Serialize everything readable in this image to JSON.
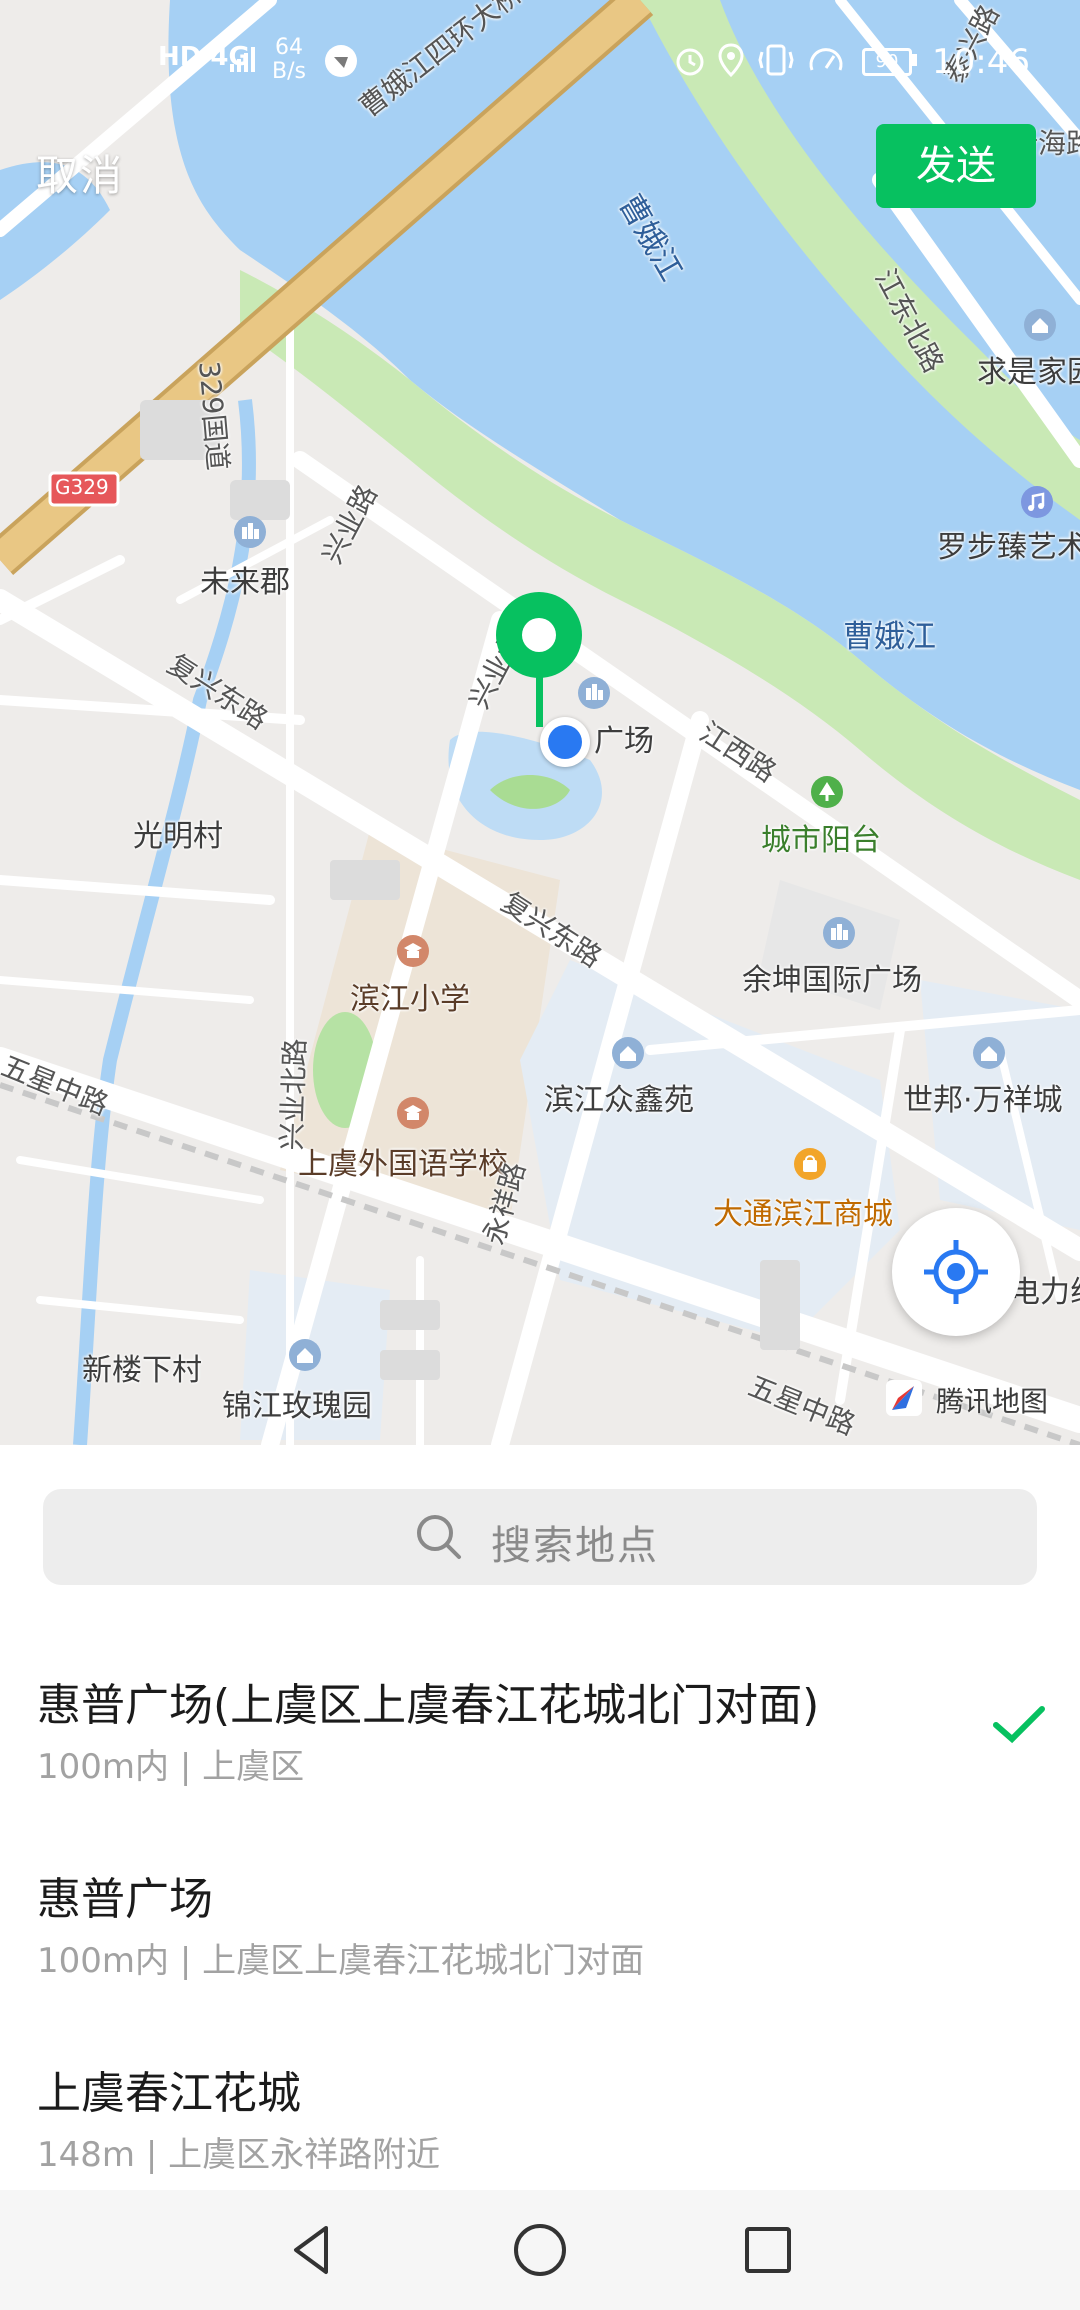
{
  "status_bar": {
    "network": "HD 4G",
    "speed_value": "64",
    "speed_unit": "B/s",
    "battery": "90",
    "time": "10:46"
  },
  "header": {
    "cancel_label": "取消",
    "send_label": "发送"
  },
  "map": {
    "labels": {
      "bridge": "曹娥江四环大桥",
      "river_top": "曹娥江",
      "river_main": "曹娥江",
      "jiangdong_road": "江东北路",
      "qiushijiayuan": "求是家园",
      "luobu": "罗步臻艺术",
      "g329": "G329",
      "weilaijun": "未来郡",
      "xingyenan": "兴业路",
      "fuxing_east_1": "复兴东路",
      "guangmingcun": "光明村",
      "huipu": "广场",
      "jiangxi_road": "江西路",
      "chengshiyangtai": "城市阳台",
      "yukun": "余坤国际广场",
      "fuxing_east_2": "复兴东路",
      "binjiang_primary": "滨江小学",
      "binjiang_zhongxin": "滨江众鑫苑",
      "shibang": "世邦·万祥城",
      "wuxing_1": "五星中路",
      "shangyu_foreign": "上虞外国语学校",
      "datong": "大通滨江商城",
      "xingyebei": "兴业北路",
      "yongxiang": "永祥路",
      "dianli": "电力线",
      "xinlouxia": "新楼下村",
      "jinjiang": "锦江玫瑰园",
      "wuxing_2": "五星中路",
      "xingye_north_small": "兴业北路",
      "road_329": "329国道",
      "top_right_road": "新海路",
      "top_right_road2": "泰兴路"
    },
    "brand": "腾讯地图",
    "colors": {
      "water": "#a6d0f4",
      "park": "#c9e9b5",
      "land": "#eeecea",
      "highway": "#e9c784",
      "pin": "#07c160",
      "user_dot": "#2979f2"
    }
  },
  "search": {
    "placeholder": "搜索地点"
  },
  "results": [
    {
      "title": "惠普广场(上虞区上虞春江花城北门对面)",
      "sub": "100m内 | 上虞区",
      "selected": true
    },
    {
      "title": "惠普广场",
      "sub": "100m内 | 上虞区上虞春江花城北门对面",
      "selected": false
    },
    {
      "title": "上虞春江花城",
      "sub": "148m | 上虞区永祥路附近",
      "selected": false
    }
  ],
  "nav_bar": {
    "back_icon": "triangle-back-icon",
    "home_icon": "circle-home-icon",
    "recents_icon": "square-recents-icon"
  }
}
